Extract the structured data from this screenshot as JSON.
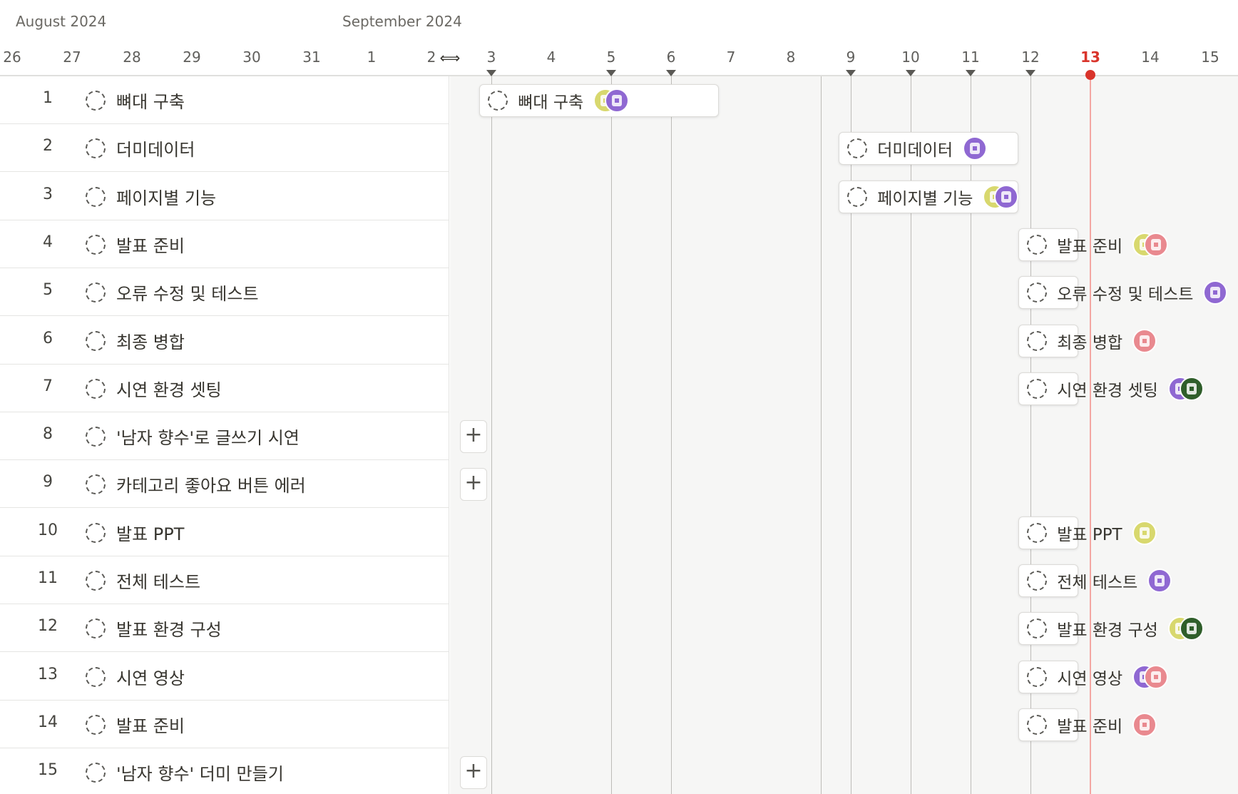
{
  "header": {
    "months": [
      {
        "label": "August 2024",
        "day": 26
      },
      {
        "label": "September 2024",
        "day": 32
      }
    ],
    "days": [
      "26",
      "27",
      "28",
      "29",
      "30",
      "31",
      "1",
      "2",
      "3",
      "4",
      "5",
      "6",
      "7",
      "8",
      "9",
      "10",
      "11",
      "12",
      "13",
      "14",
      "15"
    ],
    "today_label": "13",
    "today_index": 18,
    "milestone_day_indices": [
      8,
      10,
      11,
      14,
      15,
      16,
      17
    ],
    "resize_icon": "column-resize-icon"
  },
  "colors": {
    "today": "#d9342b",
    "avatar_yellow": "#d8d86e",
    "avatar_purple": "#8f68d2",
    "avatar_pink": "#e9898f",
    "avatar_green": "#2f5e2a"
  },
  "tasks": [
    {
      "num": "1",
      "title": "뼈대 구축",
      "start_index": 7.8,
      "end_index": 11.8,
      "avatars": [
        "yellow",
        "purple"
      ]
    },
    {
      "num": "2",
      "title": "더미데이터",
      "start_index": 13.8,
      "end_index": 16.8,
      "avatars": [
        "purple"
      ]
    },
    {
      "num": "3",
      "title": "페이지별 기능",
      "start_index": 13.8,
      "end_index": 16.8,
      "avatars": [
        "yellow",
        "purple"
      ]
    },
    {
      "num": "4",
      "title": "발표 준비",
      "start_index": 16.8,
      "end_index": 17.8,
      "avatars": [
        "yellow",
        "pink"
      ]
    },
    {
      "num": "5",
      "title": "오류 수정 및 테스트",
      "start_index": 16.8,
      "end_index": 17.8,
      "avatars": [
        "purple"
      ]
    },
    {
      "num": "6",
      "title": "최종 병합",
      "start_index": 16.8,
      "end_index": 17.8,
      "avatars": [
        "pink"
      ]
    },
    {
      "num": "7",
      "title": "시연 환경 셋팅",
      "start_index": 16.8,
      "end_index": 17.8,
      "avatars": [
        "purple",
        "green"
      ]
    },
    {
      "num": "8",
      "title": "'남자 향수'로 글쓰기 시연",
      "start_index": null,
      "end_index": null,
      "avatars": []
    },
    {
      "num": "9",
      "title": "카테고리 좋아요 버튼 에러",
      "start_index": null,
      "end_index": null,
      "avatars": []
    },
    {
      "num": "10",
      "title": "발표 PPT",
      "start_index": 16.8,
      "end_index": 17.8,
      "avatars": [
        "yellow"
      ]
    },
    {
      "num": "11",
      "title": "전체 테스트",
      "start_index": 16.8,
      "end_index": 17.8,
      "avatars": [
        "purple"
      ]
    },
    {
      "num": "12",
      "title": "발표 환경 구성",
      "start_index": 16.8,
      "end_index": 17.8,
      "avatars": [
        "yellow",
        "green"
      ]
    },
    {
      "num": "13",
      "title": "시연 영상",
      "start_index": 16.8,
      "end_index": 17.8,
      "avatars": [
        "purple",
        "pink"
      ]
    },
    {
      "num": "14",
      "title": "발표 준비",
      "start_index": 16.8,
      "end_index": 17.8,
      "avatars": [
        "pink"
      ]
    },
    {
      "num": "15",
      "title": "'남자 향수' 더미 만들기",
      "start_index": null,
      "end_index": null,
      "avatars": []
    }
  ],
  "add_button_label": "+"
}
